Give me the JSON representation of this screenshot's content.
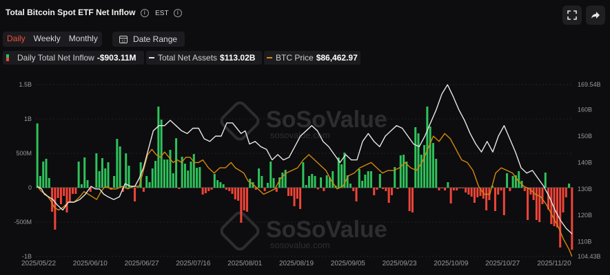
{
  "header": {
    "title": "Total Bitcoin Spot ETF Net Inflow",
    "timezone": "EST"
  },
  "toolbar": {
    "periods": [
      "Daily",
      "Weekly",
      "Monthly"
    ],
    "active_period": "Daily",
    "date_range_label": "Date Range"
  },
  "legend": {
    "inflow_label": "Daily Total Net Inflow",
    "inflow_value": "-$903.11M",
    "assets_label": "Total Net Assets",
    "assets_value": "$113.02B",
    "price_label": "BTC Price",
    "price_value": "$86,462.97"
  },
  "watermark": {
    "text": "SoSoValue",
    "sub": "sosovalue.com"
  },
  "colors": {
    "positive": "#2fc25b",
    "negative": "#f04438",
    "assets_line": "#e8e8e8",
    "price_line": "#d68a0c",
    "background": "#0d0d0f"
  },
  "chart_data": {
    "type": "bar",
    "x_tick_labels": [
      "2025/05/22",
      "2025/06/10",
      "2025/06/27",
      "2025/07/16",
      "2025/08/01",
      "2025/08/19",
      "2025/09/05",
      "2025/09/23",
      "2025/10/09",
      "2025/10/27",
      "2025/11/20"
    ],
    "y_left": {
      "ticks": [
        "1.5B",
        "1B",
        "500M",
        "0",
        "-500M",
        "-1B"
      ],
      "min": -1000,
      "max": 1500,
      "unit": "M"
    },
    "y_right": {
      "ticks": [
        "169.54B",
        "160B",
        "150B",
        "140B",
        "130B",
        "120B",
        "110B",
        "104.43B"
      ],
      "min": 104.43,
      "max": 169.54,
      "unit": "B"
    },
    "series": [
      {
        "name": "Daily Total Net Inflow",
        "values": [
          935,
          170,
          380,
          420,
          140,
          -350,
          -610,
          -150,
          -240,
          -120,
          -360,
          -200,
          -90,
          -90,
          380,
          50,
          440,
          110,
          -60,
          0,
          500,
          240,
          430,
          280,
          370,
          -30,
          170,
          710,
          600,
          -60,
          500,
          320,
          0,
          -200,
          10,
          370,
          -60,
          170,
          80,
          280,
          390,
          1180,
          990,
          410,
          410,
          550,
          210,
          720,
          -20,
          450,
          350,
          250,
          380,
          490,
          290,
          300,
          -100,
          -80,
          -50,
          -30,
          200,
          110,
          80,
          50,
          -30,
          -50,
          -90,
          -170,
          -190,
          -510,
          -330,
          -350,
          130,
          80,
          -30,
          280,
          170,
          -50,
          70,
          380,
          140,
          -60,
          150,
          220,
          260,
          -120,
          -120,
          -270,
          -160,
          -310,
          370,
          40,
          170,
          200,
          170,
          -25,
          150,
          -50,
          180,
          150,
          240,
          30,
          440,
          340,
          510,
          180,
          60,
          -50,
          -200,
          270,
          100,
          190,
          240,
          240,
          -110,
          -30,
          200,
          -20,
          -50,
          -220,
          -110,
          300,
          -20,
          470,
          480,
          380,
          -340,
          -360,
          880,
          790,
          480,
          620,
          1180,
          890,
          650,
          420,
          -40,
          -10,
          -40,
          80,
          -230,
          -40,
          -40,
          -10,
          -10,
          -70,
          -100,
          -130,
          -220,
          -140,
          -120,
          -160,
          -330,
          -180,
          30,
          -340,
          -100,
          -40,
          -400,
          210,
          -50,
          170,
          180,
          240,
          100,
          -50,
          -470,
          -100,
          -180,
          -470,
          -500,
          -240,
          220,
          -320,
          -530,
          -560,
          -580,
          -870,
          -360,
          -140,
          60,
          -903
        ]
      },
      {
        "name": "Total Net Assets",
        "points": [
          [
            0,
            131
          ],
          [
            3,
            130
          ],
          [
            5,
            128
          ],
          [
            8,
            127
          ],
          [
            11,
            126
          ],
          [
            14,
            124
          ],
          [
            18,
            122
          ],
          [
            22,
            125
          ],
          [
            26,
            125
          ],
          [
            30,
            126
          ],
          [
            34,
            128
          ],
          [
            38,
            131
          ],
          [
            41,
            130
          ],
          [
            44,
            130
          ],
          [
            47,
            128
          ],
          [
            50,
            127
          ],
          [
            54,
            126
          ],
          [
            58,
            127
          ],
          [
            62,
            132
          ],
          [
            66,
            131
          ],
          [
            69,
            131
          ],
          [
            72,
            134
          ],
          [
            75,
            138
          ],
          [
            78,
            144
          ],
          [
            82,
            152
          ],
          [
            86,
            154
          ],
          [
            90,
            154
          ],
          [
            94,
            156
          ],
          [
            98,
            154
          ],
          [
            102,
            152
          ],
          [
            106,
            151
          ],
          [
            110,
            153
          ],
          [
            114,
            153
          ],
          [
            118,
            149
          ],
          [
            122,
            148
          ],
          [
            126,
            150
          ],
          [
            130,
            150
          ],
          [
            134,
            155
          ],
          [
            138,
            155
          ],
          [
            141,
            153
          ],
          [
            144,
            151
          ],
          [
            147,
            152
          ],
          [
            150,
            147
          ],
          [
            154,
            148
          ],
          [
            158,
            146
          ],
          [
            162,
            145
          ],
          [
            166,
            141
          ],
          [
            170,
            143
          ],
          [
            174,
            141
          ],
          [
            178,
            142
          ],
          [
            182,
            146
          ],
          [
            186,
            150
          ],
          [
            190,
            152
          ],
          [
            194,
            154
          ],
          [
            198,
            152
          ],
          [
            202,
            148
          ],
          [
            206,
            146
          ],
          [
            210,
            143
          ],
          [
            214,
            140
          ],
          [
            218,
            143
          ],
          [
            222,
            141
          ],
          [
            226,
            141
          ],
          [
            230,
            148
          ],
          [
            234,
            151
          ],
          [
            238,
            148
          ],
          [
            242,
            146
          ],
          [
            246,
            150
          ],
          [
            250,
            152
          ],
          [
            254,
            154
          ],
          [
            258,
            153
          ],
          [
            262,
            150
          ],
          [
            266,
            147
          ],
          [
            270,
            146
          ],
          [
            274,
            150
          ],
          [
            278,
            155
          ],
          [
            282,
            160
          ],
          [
            286,
            166
          ],
          [
            290,
            169.5
          ],
          [
            294,
            165
          ],
          [
            298,
            160
          ],
          [
            302,
            156
          ],
          [
            306,
            151
          ],
          [
            310,
            147
          ],
          [
            314,
            144
          ],
          [
            318,
            148
          ],
          [
            322,
            144
          ],
          [
            326,
            150
          ],
          [
            330,
            154
          ],
          [
            334,
            149
          ],
          [
            338,
            144
          ],
          [
            342,
            138
          ],
          [
            346,
            136
          ],
          [
            350,
            137
          ],
          [
            354,
            134
          ],
          [
            358,
            131
          ],
          [
            362,
            127
          ],
          [
            366,
            122
          ],
          [
            370,
            118
          ],
          [
            374,
            115
          ],
          [
            378,
            113
          ]
        ]
      },
      {
        "name": "BTC Price",
        "points": [
          [
            0,
            131
          ],
          [
            3,
            129
          ],
          [
            6,
            128
          ],
          [
            9,
            126
          ],
          [
            12,
            123
          ],
          [
            15,
            122
          ],
          [
            18,
            123
          ],
          [
            22,
            125
          ],
          [
            26,
            125
          ],
          [
            30,
            127
          ],
          [
            33,
            129
          ],
          [
            36,
            128
          ],
          [
            39,
            127
          ],
          [
            42,
            126
          ],
          [
            45,
            129
          ],
          [
            48,
            131
          ],
          [
            52,
            130
          ],
          [
            56,
            130
          ],
          [
            60,
            131
          ],
          [
            64,
            130
          ],
          [
            68,
            131
          ],
          [
            72,
            131
          ],
          [
            75,
            137
          ],
          [
            78,
            143
          ],
          [
            81,
            145
          ],
          [
            84,
            143
          ],
          [
            87,
            142
          ],
          [
            90,
            144
          ],
          [
            93,
            142
          ],
          [
            96,
            140
          ],
          [
            99,
            141
          ],
          [
            102,
            140
          ],
          [
            105,
            142
          ],
          [
            108,
            142
          ],
          [
            111,
            140
          ],
          [
            114,
            140
          ],
          [
            117,
            141
          ],
          [
            121,
            138
          ],
          [
            125,
            136
          ],
          [
            129,
            138
          ],
          [
            133,
            138
          ],
          [
            137,
            140
          ],
          [
            140,
            138
          ],
          [
            143,
            137
          ],
          [
            146,
            136
          ],
          [
            149,
            133
          ],
          [
            152,
            132
          ],
          [
            156,
            130
          ],
          [
            160,
            128
          ],
          [
            164,
            129
          ],
          [
            168,
            130
          ],
          [
            172,
            134
          ],
          [
            176,
            136
          ],
          [
            180,
            137
          ],
          [
            184,
            138
          ],
          [
            188,
            141
          ],
          [
            192,
            143
          ],
          [
            196,
            141
          ],
          [
            200,
            139
          ],
          [
            204,
            137
          ],
          [
            208,
            133
          ],
          [
            212,
            130
          ],
          [
            216,
            131
          ],
          [
            220,
            135
          ],
          [
            224,
            136
          ],
          [
            228,
            138
          ],
          [
            232,
            139
          ],
          [
            236,
            140
          ],
          [
            240,
            138
          ],
          [
            244,
            136
          ],
          [
            248,
            137
          ],
          [
            252,
            137
          ],
          [
            256,
            138
          ],
          [
            260,
            140
          ],
          [
            264,
            138
          ],
          [
            268,
            137
          ],
          [
            272,
            140
          ],
          [
            276,
            145
          ],
          [
            280,
            150
          ],
          [
            284,
            148
          ],
          [
            288,
            151
          ],
          [
            292,
            149
          ],
          [
            296,
            145
          ],
          [
            300,
            141
          ],
          [
            304,
            140
          ],
          [
            308,
            137
          ],
          [
            312,
            131
          ],
          [
            316,
            128
          ],
          [
            320,
            128
          ],
          [
            324,
            136
          ],
          [
            328,
            138
          ],
          [
            332,
            137
          ],
          [
            336,
            136
          ],
          [
            340,
            133
          ],
          [
            344,
            131
          ],
          [
            348,
            130
          ],
          [
            352,
            128
          ],
          [
            356,
            127
          ],
          [
            360,
            124
          ],
          [
            364,
            120
          ],
          [
            368,
            116
          ],
          [
            372,
            111
          ],
          [
            376,
            107
          ],
          [
            378,
            104.4
          ]
        ]
      }
    ]
  }
}
